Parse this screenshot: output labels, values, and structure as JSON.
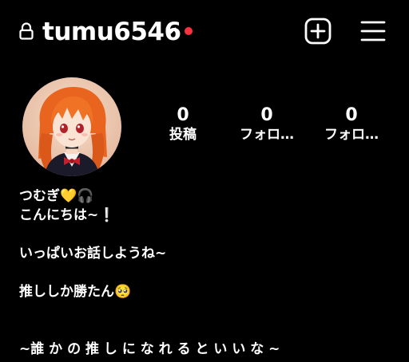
{
  "header": {
    "username": "tumu6546",
    "icons": {
      "lock": "lock-icon",
      "account_switch": "chevron-down-icon",
      "create": "plus-square-icon",
      "menu": "hamburger-menu-icon"
    },
    "notification_dot_color": "#ff3040"
  },
  "profile": {
    "avatar": "avatar-anime-girl-orange-hair",
    "stats": [
      {
        "value": "0",
        "label": "投稿"
      },
      {
        "value": "0",
        "label": "フォロ…"
      },
      {
        "value": "0",
        "label": "フォロ…"
      }
    ]
  },
  "bio": {
    "line1_text": "つむぎ",
    "line1_emoji1": "💛",
    "line1_emoji2": "🎧",
    "line2_text": "こんにちは~",
    "line2_emoji": "❕",
    "line3": "いっぱいお話しようね~",
    "line4_text": "推ししか勝たん",
    "line4_emoji": "🥺",
    "line5": "~誰 か の 推 し に な れ る と い い な ~"
  },
  "colors": {
    "background": "#000000",
    "text": "#ffffff",
    "accent_red": "#ff3040"
  }
}
